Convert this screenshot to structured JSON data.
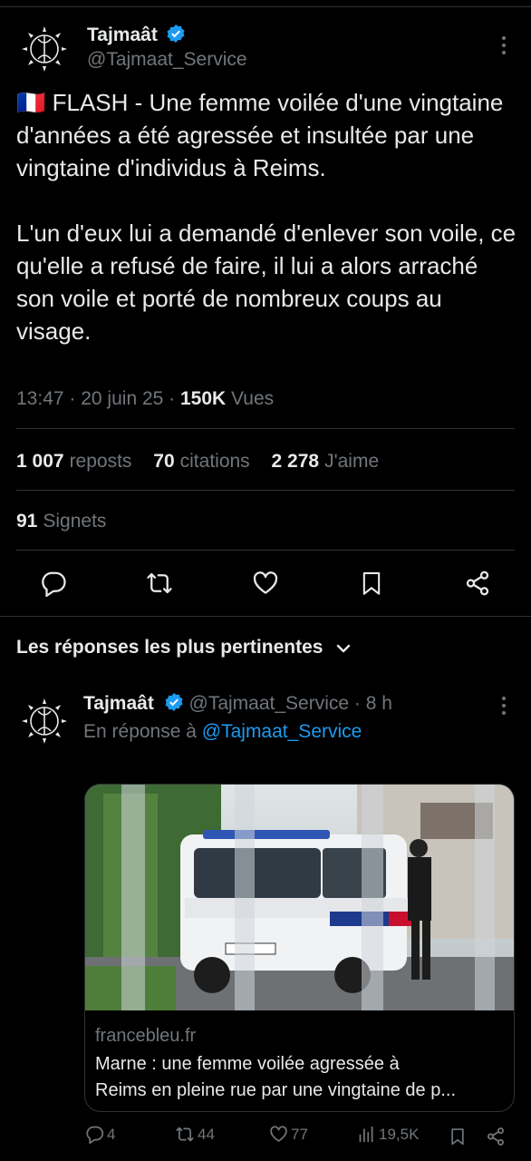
{
  "tweet": {
    "author_name": "Tajmaât",
    "author_handle": "@Tajmaat_Service",
    "text": "🇫🇷 FLASH - Une femme voilée d'une vingtaine d'années a été agressée et insultée par une vingtaine d'individus à Reims.\n\nL'un d'eux lui a demandé d'enlever son voile, ce qu'elle a refusé de faire, il lui a alors arraché son voile et porté de nombreux coups au visage.",
    "time": "13:47",
    "date": "20 juin 25",
    "views_count": "150K",
    "views_label": "Vues"
  },
  "stats": {
    "reposts_count": "1 007",
    "reposts_label": "reposts",
    "quotes_count": "70",
    "quotes_label": "citations",
    "likes_count": "2 278",
    "likes_label": "J'aime",
    "bookmarks_count": "91",
    "bookmarks_label": "Signets"
  },
  "sort_label": "Les réponses les plus pertinentes",
  "reply": {
    "author_name": "Tajmaât",
    "author_handle": "@Tajmaat_Service",
    "age": "8 h",
    "reply_prefix": "En réponse à",
    "reply_to": "@Tajmaat_Service",
    "card": {
      "domain": "francebleu.fr",
      "title_line1": "Marne : une femme voilée agressée à",
      "title_line2": "Reims en pleine rue par une vingtaine de p..."
    },
    "actions": {
      "replies": "4",
      "reposts": "44",
      "likes": "77",
      "views": "19,5K"
    }
  },
  "colors": {
    "background": "#000000",
    "text": "#e7e9ea",
    "muted": "#71767b",
    "accent": "#1d9bf0",
    "divider": "#2f3336"
  },
  "icons": [
    "verified-badge-icon",
    "more-icon",
    "reply-icon",
    "repost-icon",
    "like-icon",
    "bookmark-icon",
    "share-icon",
    "chevron-down-icon",
    "views-icon"
  ]
}
